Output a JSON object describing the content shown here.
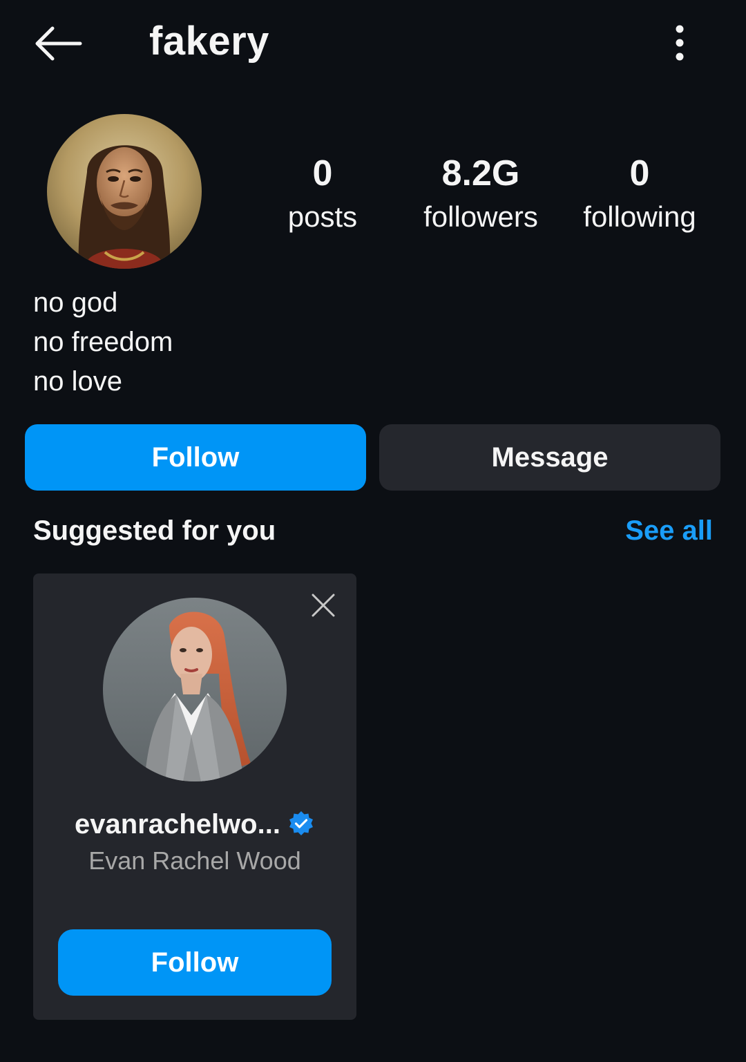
{
  "header": {
    "title": "fakery",
    "back_icon": "arrow-left-icon",
    "more_icon": "more-vertical-icon"
  },
  "profile": {
    "stats": [
      {
        "value": "0",
        "label": "posts"
      },
      {
        "value": "8.2G",
        "label": "followers"
      },
      {
        "value": "0",
        "label": "following"
      }
    ],
    "bio": [
      "no god",
      "no freedom",
      "no love"
    ]
  },
  "actions": {
    "follow_label": "Follow",
    "message_label": "Message"
  },
  "suggested": {
    "title": "Suggested for you",
    "see_all_label": "See all",
    "cards": [
      {
        "username": "evanrachelwo...",
        "full_name": "Evan Rachel Wood",
        "verified": true,
        "follow_label": "Follow"
      }
    ]
  },
  "colors": {
    "background": "#0c0f14",
    "accent": "#0095f6",
    "link": "#1a9df8",
    "secondary_button": "#25272d",
    "card": "#24262c",
    "muted_text": "#a8a8a8"
  }
}
